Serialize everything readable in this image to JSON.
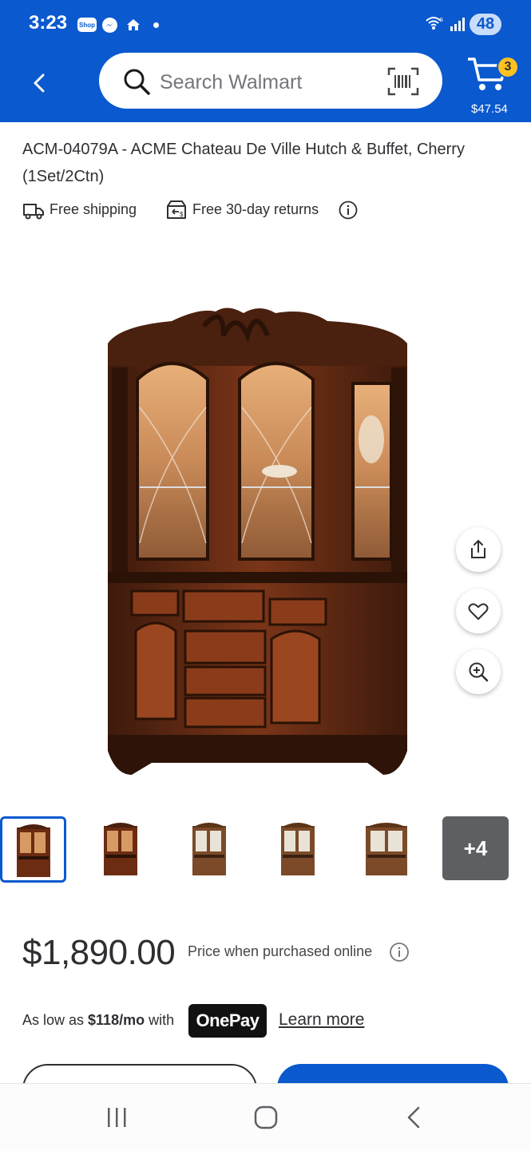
{
  "status_bar": {
    "time": "3:23",
    "shop_badge": "Shop",
    "battery": "48",
    "icons": [
      "shop-icon",
      "messenger-icon",
      "home-icon",
      "dot-icon",
      "wifi-icon",
      "signal-icon",
      "battery-icon"
    ]
  },
  "header": {
    "search_placeholder": "Search Walmart",
    "cart_count": "3",
    "cart_total": "$47.54",
    "colors": {
      "brand_blue": "#0a59ce",
      "badge_yellow": "#ffc220"
    }
  },
  "product": {
    "title": "ACM-04079A - ACME Chateau De Ville Hutch & Buffet, Cherry (1Set/2Ctn)",
    "shipping_label": "Free shipping",
    "returns_label": "Free 30-day returns",
    "thumbnails_more": "+4",
    "price": "$1,890.00",
    "price_note": "Price when purchased online",
    "low_prefix": "As low as ",
    "low_amount": "$118/mo",
    "low_suffix": " with",
    "onepay": "OnePay",
    "learn_more": "Learn more"
  }
}
